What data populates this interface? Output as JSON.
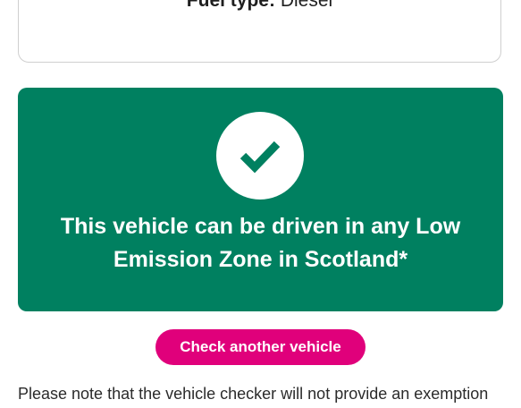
{
  "vehicle_details": {
    "fuel_type_label": "Fuel type:",
    "fuel_type_value": "Diesel"
  },
  "result": {
    "icon": "checkmark-icon",
    "line1": "This vehicle can be driven in any Low",
    "line2": "Emission Zone in Scotland*",
    "background_color": "#008060"
  },
  "actions": {
    "check_another_label": "Check another vehicle",
    "button_color": "#e0007b"
  },
  "note": {
    "text": "Please note that the vehicle checker will not provide an exemption"
  }
}
